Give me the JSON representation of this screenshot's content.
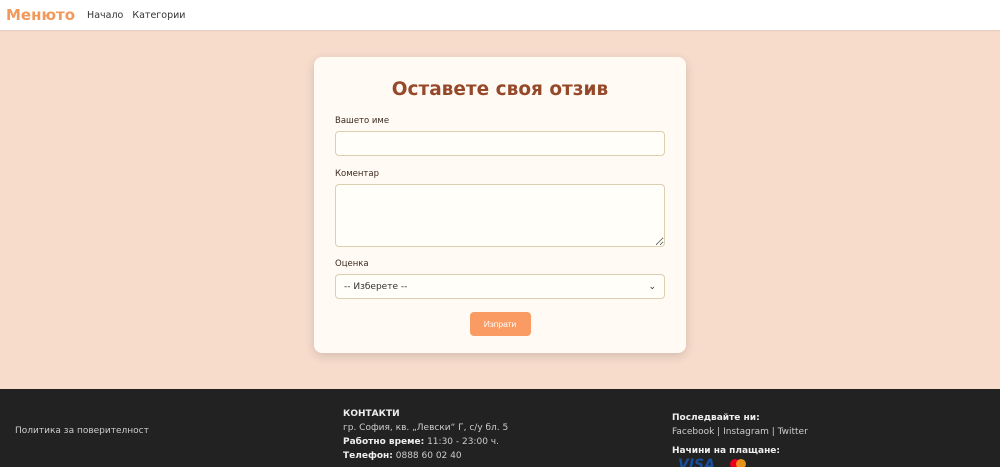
{
  "nav": {
    "brand": "Менюто",
    "links": [
      "Начало",
      "Категории"
    ]
  },
  "form": {
    "title": "Оставете своя отзив",
    "name_label": "Вашето име",
    "name_value": "",
    "comment_label": "Коментар",
    "comment_value": "",
    "rating_label": "Оценка",
    "rating_selected": "-- Изберете --",
    "submit": "Изпрати"
  },
  "footer": {
    "privacy": "Политика за поверителност",
    "contacts_title": "КОНТАКТИ",
    "address": "гр. София, кв. „Левски“ Г, с/у бл. 5",
    "hours_label": "Работно време:",
    "hours": "11:30 - 23:00 ч.",
    "phone_label": "Телефон:",
    "phone": "0888 60 02 40",
    "follow_title": "Последвайте ни:",
    "social": [
      "Facebook",
      "Instagram",
      "Twitter"
    ],
    "payments_title": "Начини на плащане:",
    "payment_methods": [
      "VISA",
      "Mastercard"
    ]
  }
}
